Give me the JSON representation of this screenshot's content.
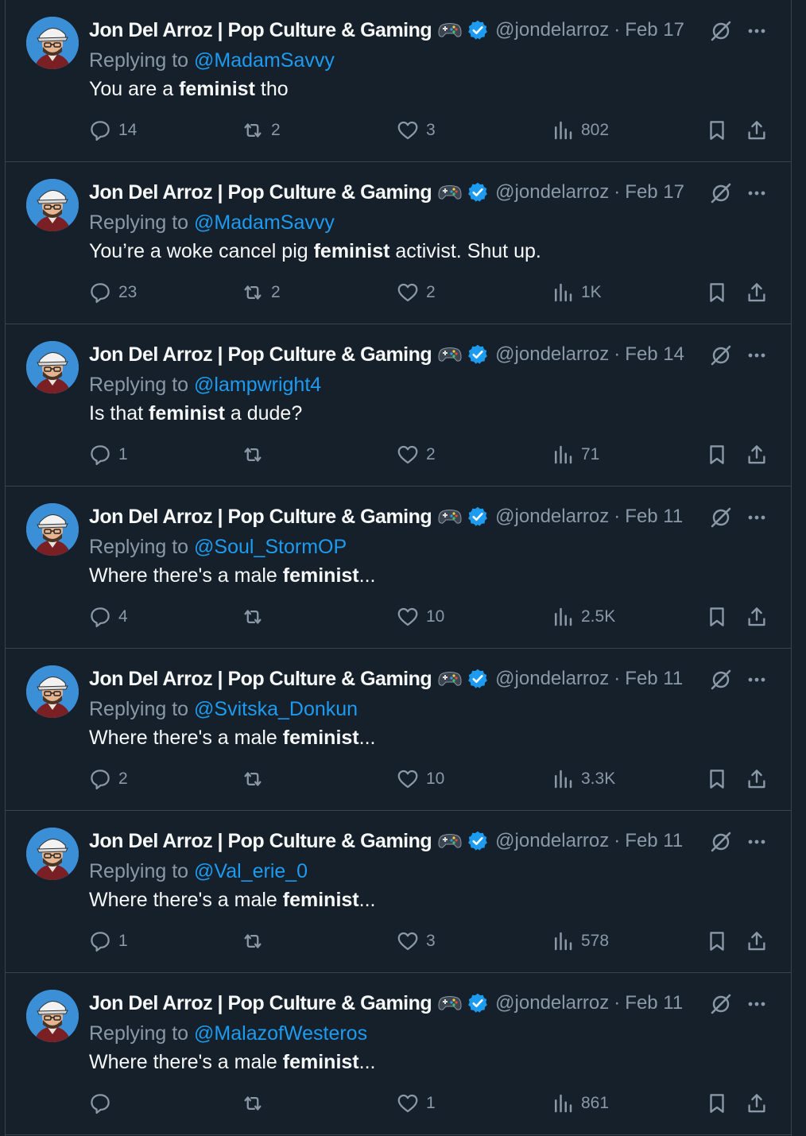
{
  "author": {
    "name": "Jon Del Arroz | Pop Culture & Gaming",
    "handle": "@jondelarroz",
    "badge_icon": "gamepad-icon",
    "verified_icon": "verified-badge-icon",
    "verified_color": "#1d9bf0"
  },
  "labels": {
    "replying_to": "Replying to",
    "separator": "·"
  },
  "colors": {
    "background": "#15202b",
    "border": "#38444d",
    "text_primary": "#f7f9f9",
    "text_secondary": "#8b98a5",
    "link": "#1d9bf0"
  },
  "tweets": [
    {
      "date": "Feb 17",
      "reply_to": "@MadamSavvy",
      "text_before": "You are a ",
      "text_bold": "feminist",
      "text_after": " tho",
      "replies": "14",
      "retweets": "2",
      "likes": "3",
      "views": "802"
    },
    {
      "date": "Feb 17",
      "reply_to": "@MadamSavvy",
      "text_before": "You’re a woke cancel pig ",
      "text_bold": "feminist",
      "text_after": " activist. Shut up.",
      "replies": "23",
      "retweets": "2",
      "likes": "2",
      "views": "1K"
    },
    {
      "date": "Feb 14",
      "reply_to": "@lampwright4",
      "text_before": "Is that ",
      "text_bold": "feminist",
      "text_after": " a dude?",
      "replies": "1",
      "retweets": "",
      "likes": "2",
      "views": "71"
    },
    {
      "date": "Feb 11",
      "reply_to": "@Soul_StormOP",
      "text_before": "Where there's a male ",
      "text_bold": "feminist",
      "text_after": "...",
      "replies": "4",
      "retweets": "",
      "likes": "10",
      "views": "2.5K"
    },
    {
      "date": "Feb 11",
      "reply_to": "@Svitska_Donkun",
      "text_before": "Where there's a male ",
      "text_bold": "feminist",
      "text_after": "...",
      "replies": "2",
      "retweets": "",
      "likes": "10",
      "views": "3.3K"
    },
    {
      "date": "Feb 11",
      "reply_to": "@Val_erie_0",
      "text_before": "Where there's a male ",
      "text_bold": "feminist",
      "text_after": "...",
      "replies": "1",
      "retweets": "",
      "likes": "3",
      "views": "578"
    },
    {
      "date": "Feb 11",
      "reply_to": "@MalazofWesteros",
      "text_before": "Where there's a male ",
      "text_bold": "feminist",
      "text_after": "...",
      "replies": "",
      "retweets": "",
      "likes": "1",
      "views": "861"
    }
  ]
}
